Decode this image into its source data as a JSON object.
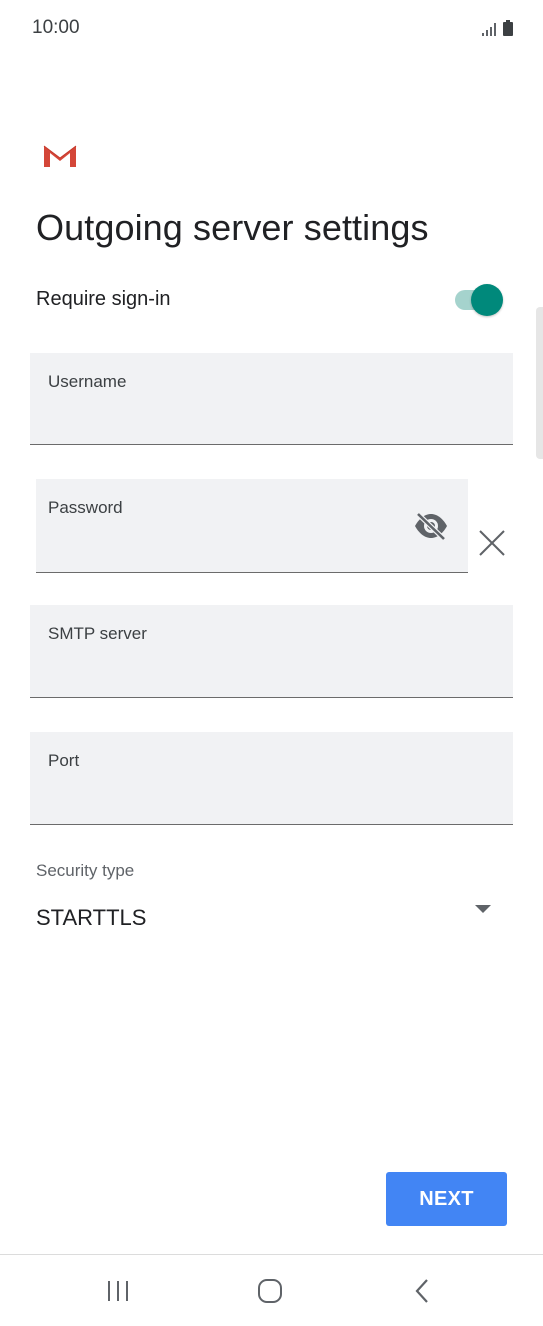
{
  "status_bar": {
    "time": "10:00"
  },
  "header": {
    "title": "Outgoing server settings"
  },
  "require_signin": {
    "label": "Require sign-in",
    "enabled": true
  },
  "fields": {
    "username": {
      "label": "Username",
      "value": ""
    },
    "password": {
      "label": "Password",
      "value": ""
    },
    "smtp_server": {
      "label": "SMTP server",
      "value": ""
    },
    "port": {
      "label": "Port",
      "value": ""
    }
  },
  "security": {
    "label": "Security type",
    "value": "STARTTLS"
  },
  "actions": {
    "next_label": "NEXT"
  },
  "icons": {
    "gmail": "gmail-logo",
    "password_visibility": "eye-off-icon",
    "clear": "close-icon",
    "dropdown": "triangle-down-icon",
    "nav": [
      "recents-icon",
      "home-icon",
      "back-icon"
    ]
  },
  "colors": {
    "toggle_on": "#00897b",
    "toggle_track": "#a5d3cd",
    "primary_button": "#4285f4",
    "field_background": "#f1f2f4"
  }
}
